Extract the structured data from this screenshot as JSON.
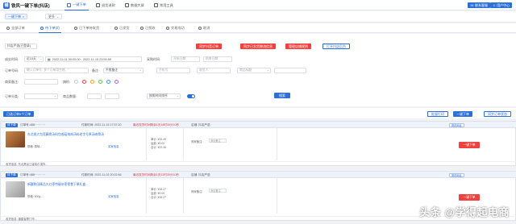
{
  "topnav": {
    "logo_mark": "铺",
    "app_title": "铁风一键下单(抖店)",
    "tabs": [
      {
        "label": "一键下单"
      },
      {
        "label": "退货退款"
      },
      {
        "label": "数据大屏"
      },
      {
        "label": "常用工具"
      }
    ],
    "btn_contact": "联系客服",
    "btn_user": "用户中心"
  },
  "subrow": {
    "pill_label": "一键下单",
    "more_label": "更多"
  },
  "status_tabs": [
    {
      "label": "全部订单"
    },
    {
      "label": "待下单(2)"
    },
    {
      "label": "已下单待发货"
    },
    {
      "label": "已发货"
    },
    {
      "label": "已揽收"
    },
    {
      "label": "交易成功"
    },
    {
      "label": "取消"
    }
  ],
  "filter": {
    "shop_select": "抖店严选(已登录)",
    "btn_sync_order": "同步抖音订单",
    "btn_sync_logistics": "同步已发货物流信息",
    "btn_manage_rules": "管理店铺规则",
    "btn_open_shop": "打开抖店后台",
    "label_order_time": "成交时间:",
    "time_preset": "近15天",
    "time_range": "2022-11-01 00:00:00 - 2022-11-15 23:59:59",
    "label_pay_time": "采购时间:",
    "pay_start_placeholder": "开始日期",
    "pay_end_placeholder": "结束日期",
    "label_order_no": "订单号码:",
    "order_no_placeholder": "输入订单号, 多个订单用空格、\"",
    "label_remark": "备注:",
    "remark_value": "不限备注",
    "phone_placeholder": "手机号",
    "receiver_placeholder": "收货人",
    "product_placeholder": "商品标题",
    "label_buyer_remark": "商家备注:",
    "label_flag": "旗帜:",
    "label_type": "类型:",
    "label_order_type": "订单分类:",
    "label_qty": "商品数量:",
    "label_pay_method": "按照时间排序",
    "btn_search": "搜索",
    "flag_colors": [
      "#ffffff",
      "#e94848",
      "#f5a623",
      "#6dbd45",
      "#4a90e2",
      "#a868e8"
    ]
  },
  "actions": {
    "selected_text": "已选订单0个订单",
    "btn_batch_print": "批量打印",
    "btn_one_click": "一键下单",
    "btn_sync_status": "同步订单状态"
  },
  "orders": [
    {
      "tag": "待下单",
      "order_no_label": "订单号:",
      "order_no": "488···········",
      "time": "付款时间: 2022-11-15 17:57:20",
      "warn": "最迟发货时间剩余1天18时35分10秒",
      "shop": "店铺: 抖店严选",
      "title": "东北香大包莲藕骨汤料包香菇炖肉汤料老字号原汤肉骨汤",
      "sku": "规格: 原味...",
      "buyer": "买家信息",
      "price_lines": [
        "单价: ¥15.49",
        "运费: ¥0.00",
        "合计: ¥22.46"
      ],
      "remark_label": "商家备注:",
      "remark_btn": "添加备注",
      "action_btn": "一键下单",
      "mini_btn": "修改地址",
      "footer": "收货信息: 东北黑龙江省哈尔滨市..."
    },
    {
      "tag": "待下单",
      "order_no_label": "订单号:",
      "order_no": "488···········",
      "time": "付款时间: 2022-11-02 20:22:46",
      "warn": "最迟发货时间剩余1天22时35分10秒",
      "shop": "店铺: 抖店严选",
      "title": "新疆和田精品大红枣特级灰枣零食干果礼盒...",
      "sku": "规格: 500g...",
      "buyer": "买家信息",
      "price_lines": [
        "单价: ¥18.27",
        "运费: ¥0.00",
        "合计: ¥18.27"
      ],
      "remark_label": "商家备注:",
      "remark_btn": "添加备注",
      "action_btn": "一键下单",
      "mini_btn": "修改地址",
      "footer": "收货信息: 福建省厦门市..."
    }
  ],
  "watermark": "头条 @学得起电商"
}
